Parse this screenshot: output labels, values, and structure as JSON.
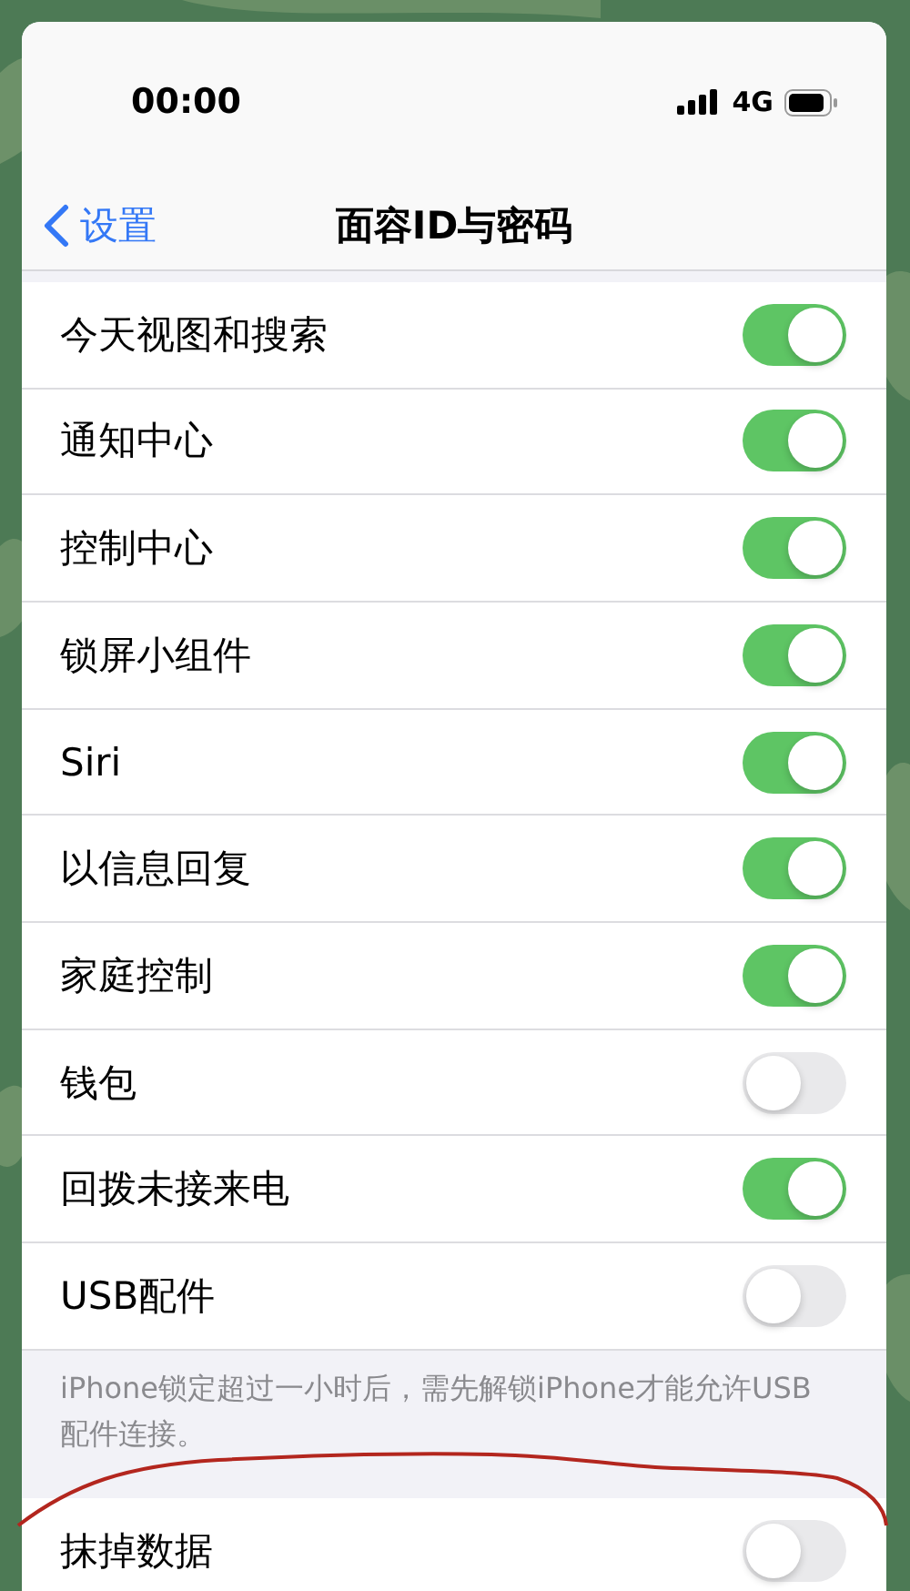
{
  "status_bar": {
    "time": "00:00",
    "network": "4G"
  },
  "nav": {
    "back": "设置",
    "title": "面容ID与密码"
  },
  "settings": [
    {
      "label": "今天视图和搜索",
      "on": true
    },
    {
      "label": "通知中心",
      "on": true
    },
    {
      "label": "控制中心",
      "on": true
    },
    {
      "label": "锁屏小组件",
      "on": true
    },
    {
      "label": "Siri",
      "on": true
    },
    {
      "label": "以信息回复",
      "on": true
    },
    {
      "label": "家庭控制",
      "on": true
    },
    {
      "label": "钱包",
      "on": false
    },
    {
      "label": "回拨未接来电",
      "on": true
    },
    {
      "label": "USB配件",
      "on": false
    }
  ],
  "footer": "iPhone锁定超过一小时后，需先解锁iPhone才能允许USB配件连接。",
  "erase": {
    "label": "抹掉数据",
    "on": false
  }
}
